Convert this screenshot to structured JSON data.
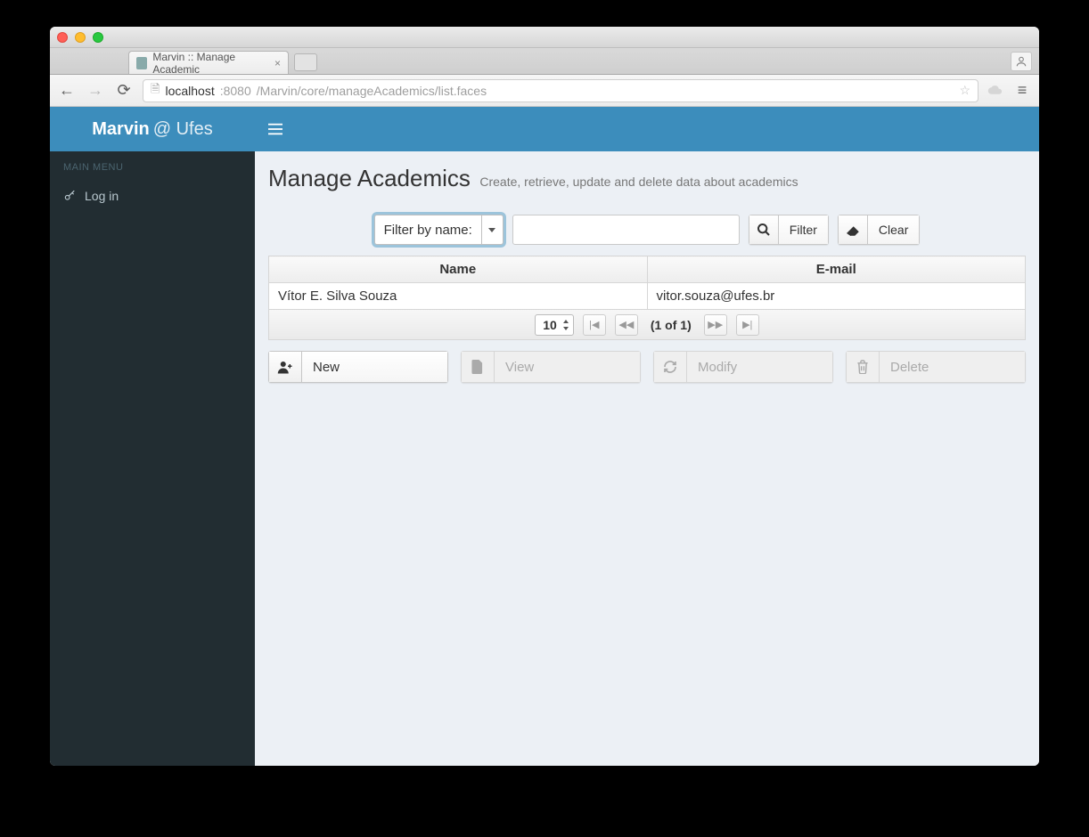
{
  "browser": {
    "tab_title": "Marvin :: Manage Academic",
    "url_host": "localhost",
    "url_port": ":8080",
    "url_path": "/Marvin/core/manageAcademics/list.faces"
  },
  "brand": {
    "bold": "Marvin",
    "light": "@ Ufes"
  },
  "sidebar": {
    "header": "MAIN MENU",
    "items": [
      {
        "label": "Log in"
      }
    ]
  },
  "page": {
    "title": "Manage Academics",
    "subtitle": "Create, retrieve, update and delete data about academics"
  },
  "filter": {
    "select_label": "Filter by name:",
    "input_value": "",
    "filter_btn": "Filter",
    "clear_btn": "Clear"
  },
  "table": {
    "columns": [
      "Name",
      "E-mail"
    ],
    "rows": [
      {
        "name": "Vítor E. Silva Souza",
        "email": "vitor.souza@ufes.br"
      }
    ]
  },
  "paginator": {
    "page_size": "10",
    "info": "(1 of 1)"
  },
  "actions": {
    "new": "New",
    "view": "View",
    "modify": "Modify",
    "delete": "Delete"
  }
}
